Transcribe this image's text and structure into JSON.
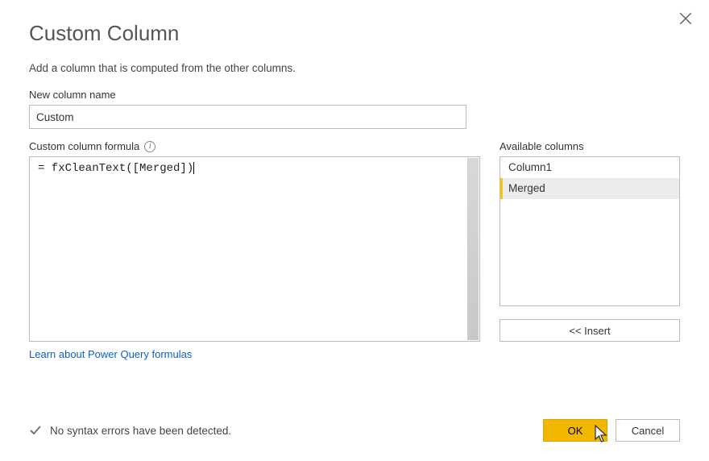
{
  "dialog": {
    "title": "Custom Column",
    "description": "Add a column that is computed from the other columns."
  },
  "name_field": {
    "label": "New column name",
    "value": "Custom"
  },
  "formula_field": {
    "label": "Custom column formula",
    "value": "= fxCleanText([Merged])"
  },
  "available": {
    "label": "Available columns",
    "items": [
      "Column1",
      "Merged"
    ],
    "selected_index": 1,
    "insert_label": "<< Insert"
  },
  "link": {
    "text": "Learn about Power Query formulas"
  },
  "status": {
    "text": "No syntax errors have been detected."
  },
  "buttons": {
    "ok": "OK",
    "cancel": "Cancel"
  }
}
